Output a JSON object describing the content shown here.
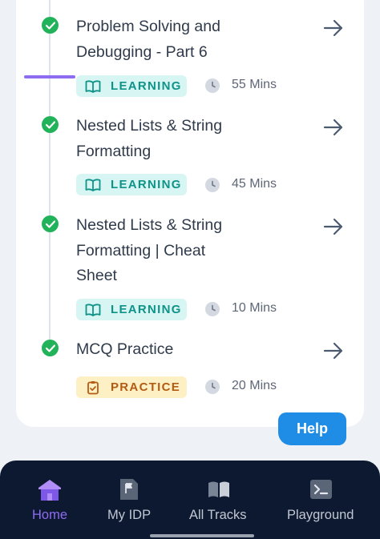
{
  "lessons": [
    {
      "title_line1": "Problem Solving and",
      "title_line2": "Debugging - Part 6",
      "title_line3": "",
      "type": "LEARNING",
      "duration": "55 Mins"
    },
    {
      "title_line1": "Nested Lists & String",
      "title_line2": "Formatting",
      "title_line3": "",
      "type": "LEARNING",
      "duration": "45 Mins"
    },
    {
      "title_line1": "Nested Lists & String",
      "title_line2": "Formatting | Cheat",
      "title_line3": "Sheet",
      "type": "LEARNING",
      "duration": "10 Mins"
    },
    {
      "title_line1": "MCQ Practice",
      "title_line2": "",
      "title_line3": "",
      "type": "PRACTICE",
      "duration": "20 Mins"
    }
  ],
  "help": {
    "label": "Help"
  },
  "nav": {
    "items": [
      {
        "label": "Home",
        "icon": "home-icon",
        "active": true
      },
      {
        "label": "My IDP",
        "icon": "flag-document-icon",
        "active": false
      },
      {
        "label": "All Tracks",
        "icon": "open-book-icon",
        "active": false
      },
      {
        "label": "Playground",
        "icon": "terminal-icon",
        "active": false
      }
    ]
  },
  "colors": {
    "complete_check": "#22b35a",
    "learning_badge_bg": "#d7f6f3",
    "learning_badge_text": "#0f9389",
    "practice_badge_bg": "#fdf0c4",
    "practice_badge_text": "#b45b13",
    "nav_background": "#0d1931",
    "nav_active": "#8e6cf2",
    "help_button": "#1f8ce6"
  }
}
